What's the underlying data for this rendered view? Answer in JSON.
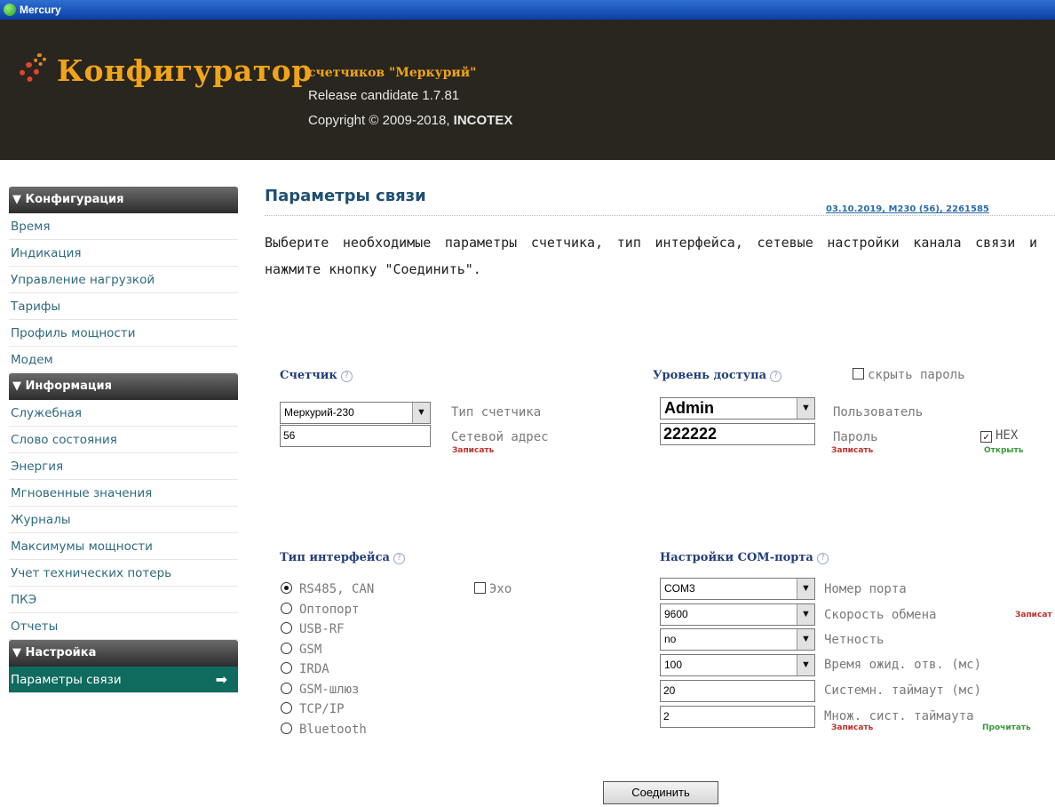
{
  "window": {
    "title": "Mercury",
    "app_icon": "mercury-app-icon"
  },
  "header": {
    "title": "Конфигуратор",
    "subtitle": "счетчиков \"Меркурий\"",
    "release": "Release candidate 1.7.81",
    "copyright_prefix": "Copyright © 2009-2018, ",
    "company": "INCOTEX",
    "logo_icon": "gears-icon"
  },
  "sidebar": {
    "sections": [
      {
        "title": "▼ Конфигурация",
        "items": [
          "Время",
          "Индикация",
          "Управление нагрузкой",
          "Тарифы",
          "Профиль мощности",
          "Модем"
        ]
      },
      {
        "title": "▼ Информация",
        "items": [
          "Служебная",
          "Слово состояния",
          "Энергия",
          "Мгновенные значения",
          "Журналы",
          "Максимумы мощности",
          "Учет технических потерь",
          "ПКЭ",
          "Отчеты"
        ]
      },
      {
        "title": "▼ Настройка",
        "items": [
          "Параметры связи"
        ]
      }
    ],
    "active_item": "Параметры связи",
    "active_arrow": "➡"
  },
  "main": {
    "title": "Параметры связи",
    "meta": "03.10.2019, M230 (56), 2261585",
    "intro": "Выберите необходимые параметры счетчика, тип интерфейса, сетевые настройки канала связи и нажмите кнопку \"Соединить\".",
    "meter": {
      "heading": "Счетчик",
      "type_value": "Меркурий-230",
      "type_label": "Тип счетчика",
      "address_value": "56",
      "address_label": "Сетевой адрес",
      "write_label": "Записать"
    },
    "access": {
      "heading": "Уровень доступа",
      "hide_password_label": "скрыть пароль",
      "hide_password_checked": false,
      "user_value": "Admin",
      "user_label": "Пользователь",
      "password_value": "222222",
      "password_label": "Пароль",
      "hex_label": "HEX",
      "hex_checked": true,
      "write_label": "Записать",
      "open_label": "Открыть"
    },
    "interface": {
      "heading": "Тип интерфейса",
      "options": [
        "RS485, CAN",
        "Оптопорт",
        "USB-RF",
        "GSM",
        "IRDA",
        "GSM-шлюз",
        "TCP/IP",
        "Bluetooth"
      ],
      "selected": "RS485, CAN",
      "echo_label": "Эхо",
      "echo_checked": false
    },
    "com": {
      "heading": "Настройки COM-порта",
      "port_value": "COM3",
      "port_label": "Номер порта",
      "baud_value": "9600",
      "baud_label": "Скорость обмена",
      "baud_write": "Записат",
      "parity_value": "no",
      "parity_label": "Четность",
      "timeout_value": "100",
      "timeout_label": "Время ожид. отв. (мс)",
      "sys_timeout_value": "20",
      "sys_timeout_label": "Системн. таймаут (мс)",
      "sys_mult_value": "2",
      "sys_mult_label": "Множ. сист. таймаута",
      "write_label": "Записать",
      "read_label": "Прочитать"
    },
    "connect_button": "Соединить"
  }
}
